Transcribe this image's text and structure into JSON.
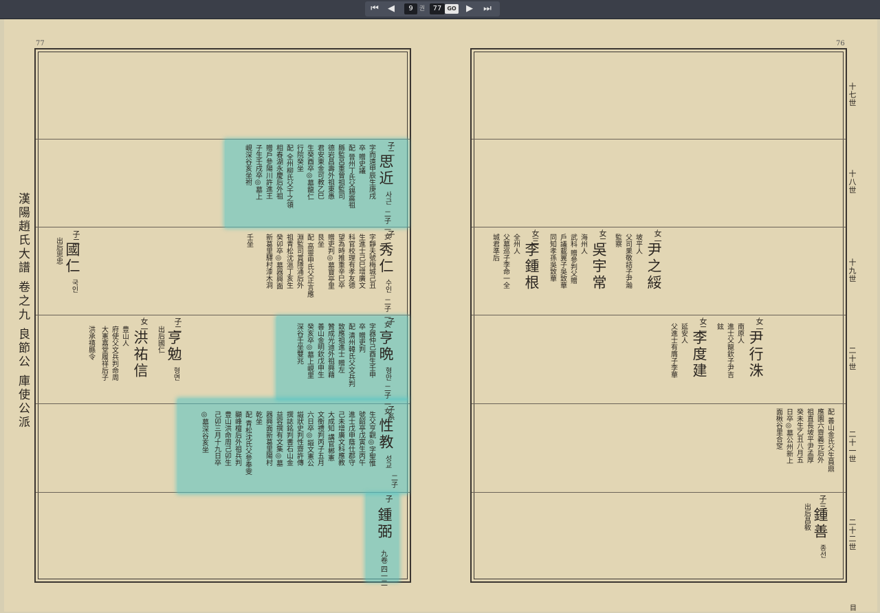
{
  "toolbar": {
    "first": "⏮",
    "prev": "◀",
    "vol": "9",
    "vol_unit": "권",
    "page": "77",
    "go": "GO",
    "next": "▶",
    "last": "⏭"
  },
  "left_page": {
    "number": "77",
    "title": "漢陽趙氏大譜 卷之九 良節公 庫使公派"
  },
  "right_page": {
    "number": "76"
  },
  "generations": [
    "十七世",
    "十八世",
    "十九世",
    "二十世",
    "二十一世",
    "二十二世"
  ],
  "bottom_mark": "目",
  "entries": {
    "sageun": {
      "rel": "子二",
      "name": "思近",
      "ko": "사근",
      "mark": "二子 一女",
      "cols": [
        "字而遠甲辰生庚戌",
        "卒 贈史議",
        "配 晉州丁氏父錫震祖",
        "縣監呂重曾祖監司",
        "德岩昌壽外祖東愚",
        "君安東金可教乙巳",
        "生癸酉卒◎墓龍仁",
        "行院癸坐",
        "配 全州柳氏父千之領",
        "相春湖永慶后外祖",
        "贈戶參陽川許進王",
        "子生壬戌卒◎墓上",
        "峴深谷亥坐祔"
      ]
    },
    "suin": {
      "rel": "子",
      "name": "秀仁",
      "ko": "수인",
      "mark": "二子 一女",
      "cols": [
        "字靜夫號梅城己丑",
        "生進士己巳增廣文",
        "科官校理有孝友德",
        "望為時推重辛巳卒",
        "贈吏判◎墓寶亭里",
        "艮坐",
        "配 高靈申氏父正言應",
        "淵監司賞隱涌后外",
        "祖青松沈㴩丁亥生",
        "癸卯卒◎墓器興面",
        "新葛里驛村漆木洞",
        "壬坐"
      ]
    },
    "gugin": {
      "rel": "子二",
      "name": "國仁",
      "ko": "국인",
      "note": "出后思忠"
    },
    "hyeongman": {
      "rel": "子",
      "name": "亨晩",
      "ko": "형만",
      "mark": "二子 一女",
      "cols": [
        "字器仲己酉生壬申",
        "卒 贈吏判",
        "配 清州韓氏父文兵判",
        "致應祖進士 贈左",
        "贊成光迪外祖興藉",
        "善山金明欽戊申生",
        "癸亥卒◎墓上峴里",
        "深谷壬坐雙兆"
      ]
    },
    "hyeongmyeon": {
      "rel": "子二",
      "name": "亨勉",
      "ko": "형면",
      "note": "出后國仁"
    },
    "hongugsin": {
      "rel": "女一",
      "name": "洪祐信",
      "cols": [
        "豊山人",
        "府使父文兵判命周",
        "大憲嘉堂履祥后子",
        "洪承禧縣令"
      ]
    },
    "seonggyo": {
      "rel": "子系",
      "name": "性教",
      "ko": "성교",
      "mark": "二子",
      "cols": [
        "生父亨觀◎字聖惟",
        "號韶亭戊寅生丙午",
        "進士戊申蔭仕郡守",
        "己未增廣文科應教",
        "大成知 講官郴憲",
        "文衡禮判丙子五月",
        "六日卒◎謚文憲公",
        "謚狀史判性齋許傳",
        "撰誌銘判書石山金",
        "益容撰有文集◎墓",
        "器興面新葛里陽村",
        "乾坐",
        "配 青松沈氏父參奉雯",
        "顯峰檀后外祖兵判",
        "豊山洪命周己卯生",
        "己卯三月十九日卒",
        "◎墓深谷亥坐"
      ]
    },
    "jongyak": {
      "rel": "子",
      "name": "鍾弼",
      "vol": "九卷 四一二"
    },
    "yunjisu": {
      "rel": "女一",
      "name": "尹之綏",
      "cols": [
        "坡平人",
        "父司果敬詰子尹瀚",
        "監察"
      ]
    },
    "ohusang": {
      "rel": "女二",
      "name": "吳宇常",
      "cols": [
        "海州人",
        "武科 贈參判父贈",
        "戶議載翼子吳致華",
        "同知孝孫吳致華"
      ]
    },
    "ijonggeun": {
      "rel": "女三",
      "name": "李鍾根",
      "cols": [
        "全州人",
        "父墓巡子李命一全",
        "城君準后"
      ]
    },
    "yunhaengsu": {
      "rel": "女一",
      "name": "尹行洙",
      "cols": [
        "南原人",
        "進士父龍欽子尹吉",
        "鉉"
      ]
    },
    "idogeon": {
      "rel": "女二",
      "name": "李度建",
      "cols": [
        "延安人",
        "父進士有膺子李華"
      ]
    },
    "wife21": {
      "cols": [
        "配 善山金氏父生員鼎",
        "應園六齋義元后外",
        "祖直長坡平尹孟厚",
        "癸未生乙丑八月五",
        "日卒◎墓公州新上",
        "面楸谷里合窆"
      ]
    },
    "jongseon": {
      "rel": "子三",
      "name": "鍾善",
      "ko": "종선",
      "note": "出后昌敎"
    }
  }
}
